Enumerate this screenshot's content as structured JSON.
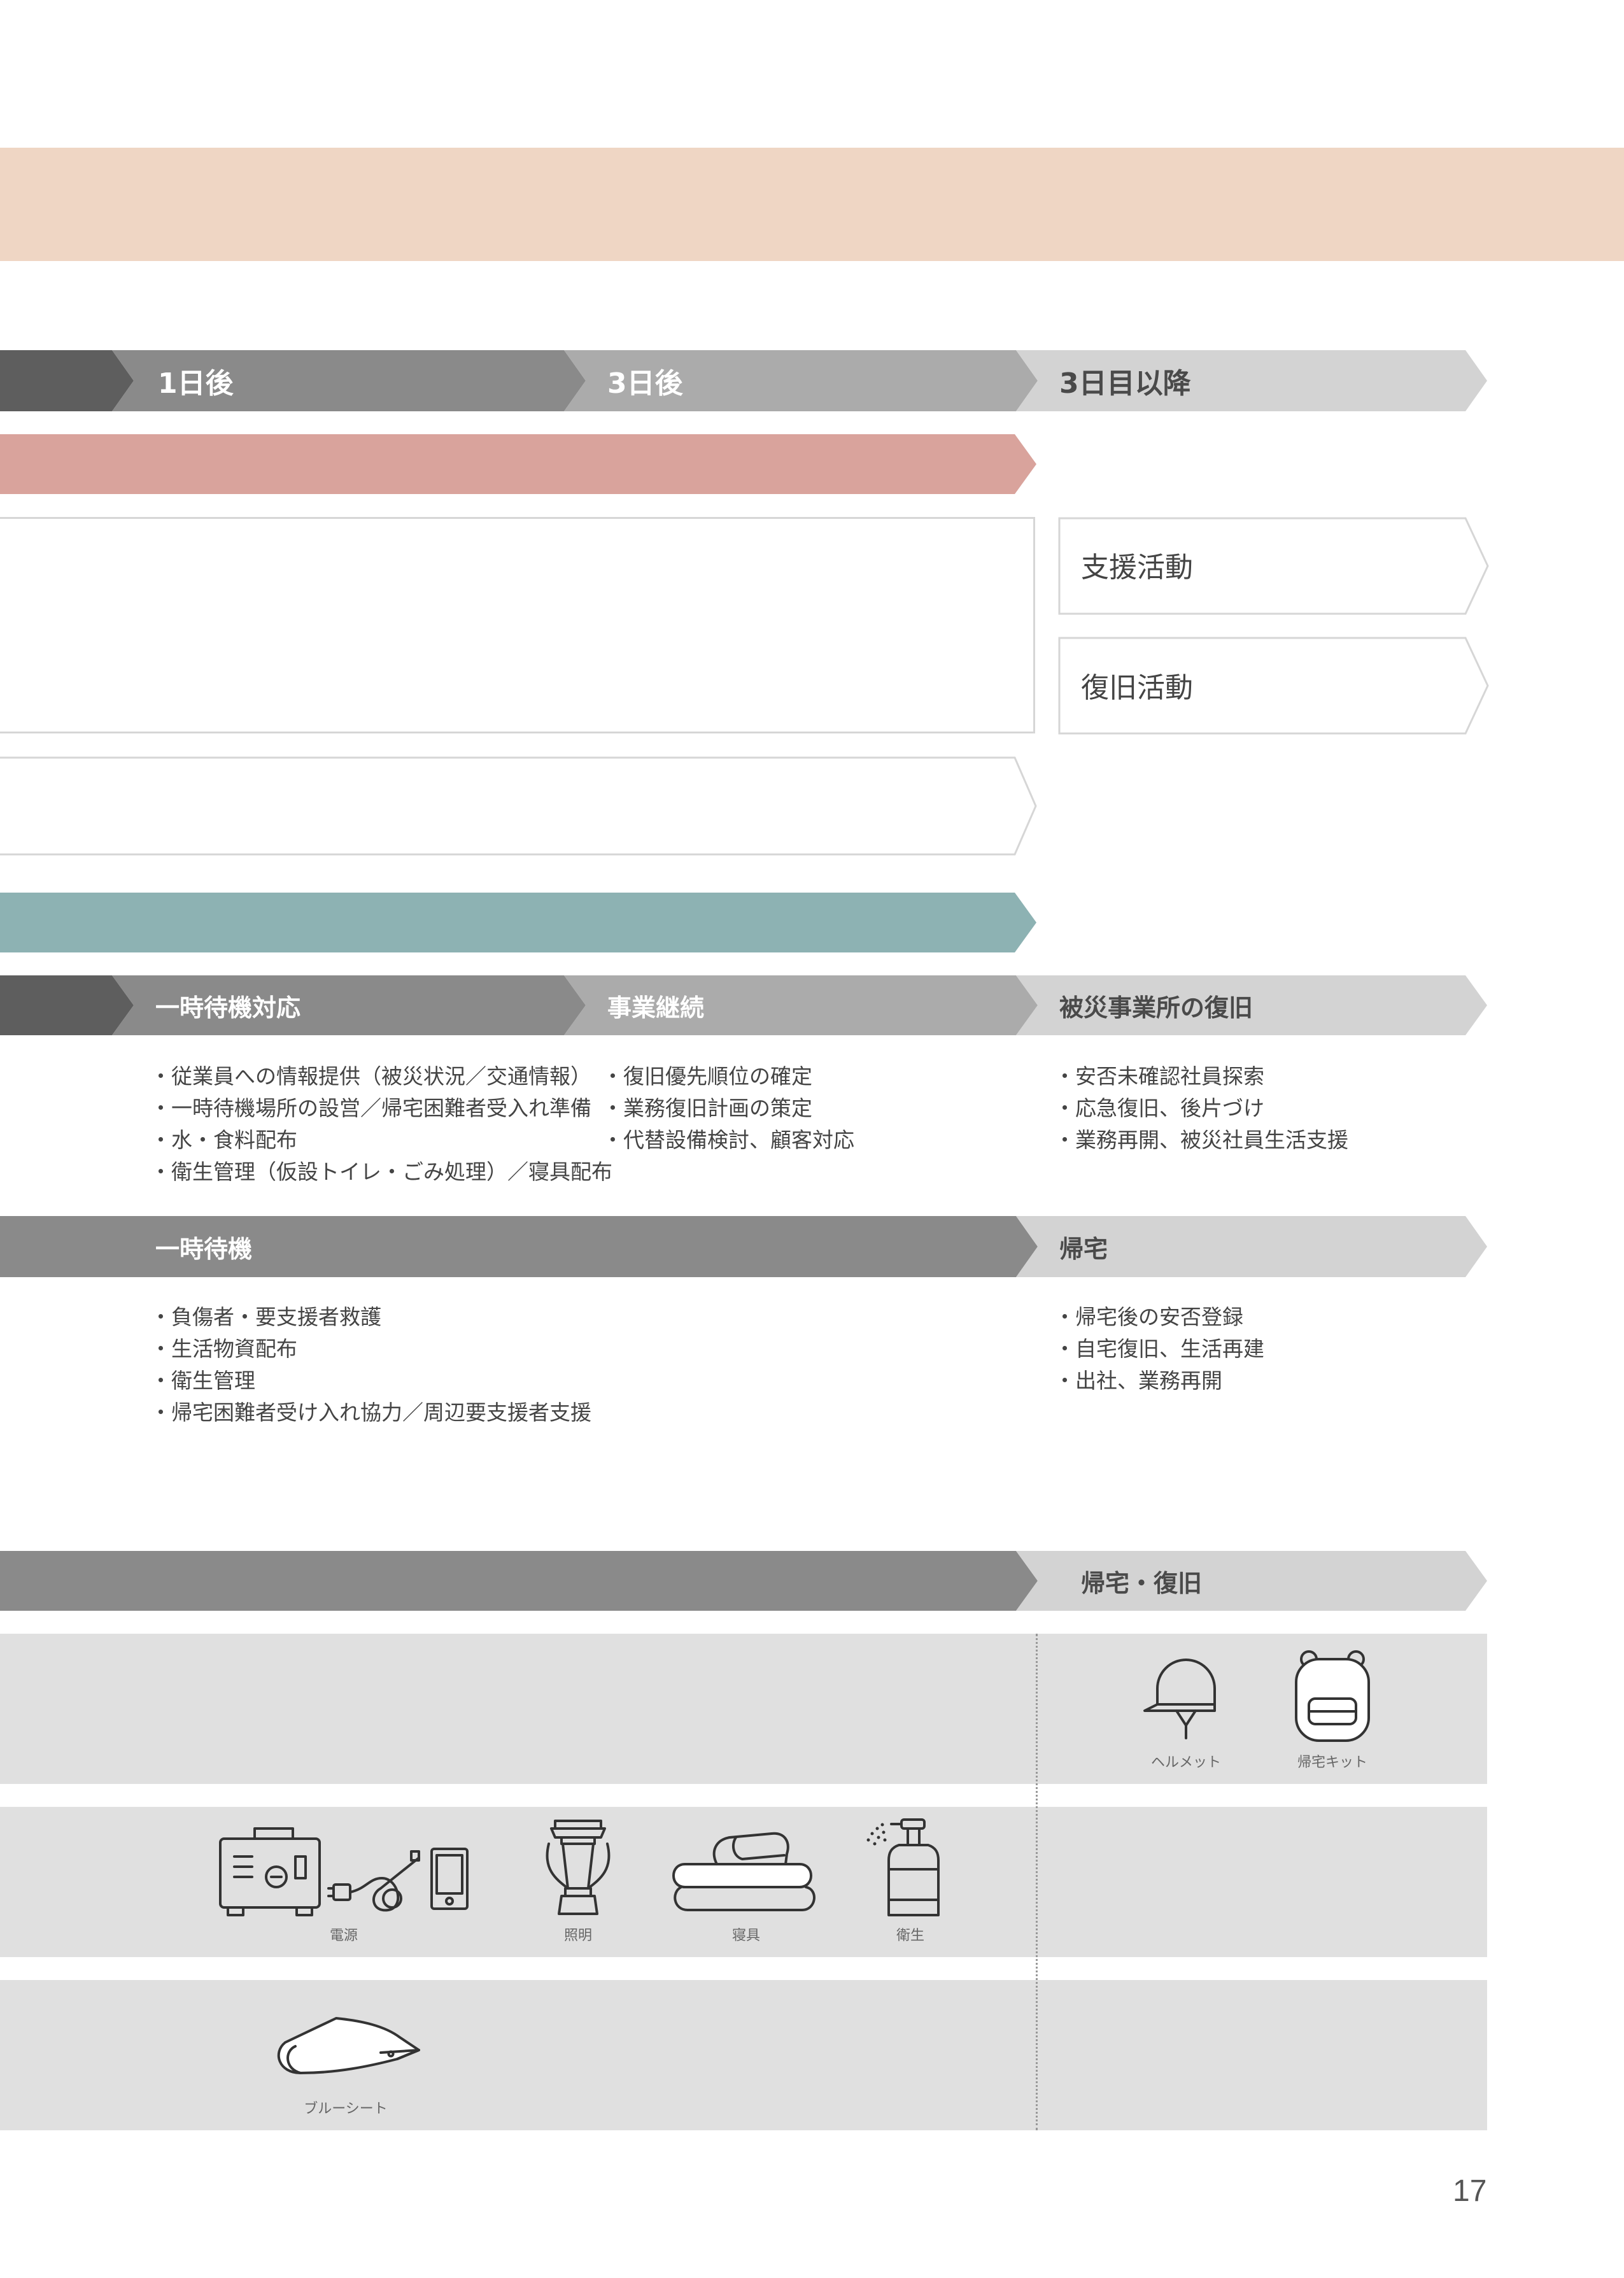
{
  "timeline": {
    "labels": [
      "1日後",
      "3日後",
      "3日目以降"
    ]
  },
  "right_boxes": {
    "support": "支援活動",
    "recovery": "復旧活動"
  },
  "company": {
    "phases": [
      "一時待機対応",
      "事業継続",
      "被災事業所の復旧"
    ],
    "col1": [
      "従業員への情報提供（被災状況／交通情報）",
      "一時待機場所の設営／帰宅困難者受入れ準備",
      "水・食料配布",
      "衛生管理（仮設トイレ・ごみ処理）／寝具配布"
    ],
    "col2": [
      "復旧優先順位の確定",
      "業務復旧計画の策定",
      "代替設備検討、顧客対応"
    ],
    "col3": [
      "安否未確認社員探索",
      "応急復旧、後片づけ",
      "業務再開、被災社員生活支援"
    ]
  },
  "employee": {
    "phases": [
      "一時待機",
      "帰宅"
    ],
    "col1": [
      "負傷者・要支援者救護",
      "生活物資配布",
      "衛生管理",
      "帰宅困難者受け入れ協力／周辺要支援者支援"
    ],
    "col3": [
      "帰宅後の安否登録",
      "自宅復旧、生活再建",
      "出社、業務再開"
    ]
  },
  "supplies": {
    "header_right": "帰宅・復旧",
    "row1_icons": [
      {
        "icon": "helmet-icon",
        "label": "ヘルメット"
      },
      {
        "icon": "backpack-icon",
        "label": "帰宅キット"
      }
    ],
    "row2_icons": [
      {
        "icon": "power-icon",
        "label": "電源"
      },
      {
        "icon": "lantern-icon",
        "label": "照明"
      },
      {
        "icon": "bedding-icon",
        "label": "寝具"
      },
      {
        "icon": "sanitizer-icon",
        "label": "衛生"
      }
    ],
    "row3_icons": [
      {
        "icon": "tarp-icon",
        "label": "ブルーシート"
      }
    ]
  },
  "page_number": "17",
  "colors": {
    "peach": "#efd6c4",
    "rose": "#d9a39c",
    "teal": "#8db2b3",
    "dark_grey": "#5e5e5e",
    "mid_grey": "#8a8a8a",
    "light_grey": "#ababab",
    "pale_grey": "#d3d3d3",
    "row_grey": "#e0e0e0"
  }
}
